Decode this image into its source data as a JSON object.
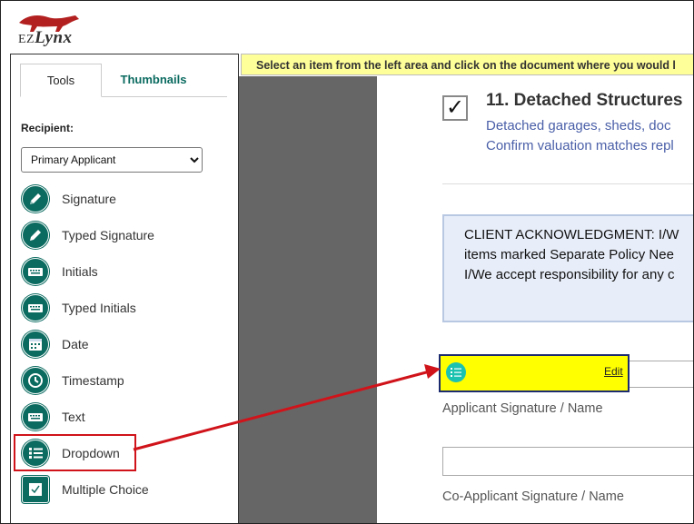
{
  "logo": {
    "ez": "EZ",
    "lynx": "Lynx"
  },
  "tabs": [
    {
      "label": "Tools"
    },
    {
      "label": "Thumbnails"
    }
  ],
  "recipient": {
    "label": "Recipient:",
    "selected": "Primary Applicant",
    "options": [
      "Primary Applicant"
    ]
  },
  "tools": [
    {
      "label": "Signature",
      "icon": "pen-icon"
    },
    {
      "label": "Typed Signature",
      "icon": "pen-icon"
    },
    {
      "label": "Initials",
      "icon": "keyboard-icon"
    },
    {
      "label": "Typed Initials",
      "icon": "keyboard-icon"
    },
    {
      "label": "Date",
      "icon": "calendar-icon"
    },
    {
      "label": "Timestamp",
      "icon": "clock-icon"
    },
    {
      "label": "Text",
      "icon": "keyboard-icon"
    },
    {
      "label": "Dropdown",
      "icon": "list-icon"
    },
    {
      "label": "Multiple Choice",
      "icon": "checkbox-icon"
    }
  ],
  "banner": {
    "text": "Select an item from the left area and click on the document where you would l"
  },
  "document": {
    "section_title": "11. Detached Structures",
    "section_desc_1": "Detached garages, sheds, doc",
    "section_desc_2": "Confirm valuation matches repl",
    "check_mark": "✓",
    "ack_lines": [
      "CLIENT ACKNOWLEDGMENT: I/W",
      "items marked Separate Policy Nee",
      "I/We accept responsibility for any c"
    ],
    "dropdown_field": {
      "edit_label": "Edit"
    },
    "sig_label_1": "Applicant Signature / Name",
    "sig_label_2": "Co-Applicant Signature / Name"
  },
  "colors": {
    "brand_teal": "#0b6b60",
    "highlight_red": "#d0131a",
    "field_yellow": "#ffff00",
    "banner_yellow": "#ffff99"
  }
}
